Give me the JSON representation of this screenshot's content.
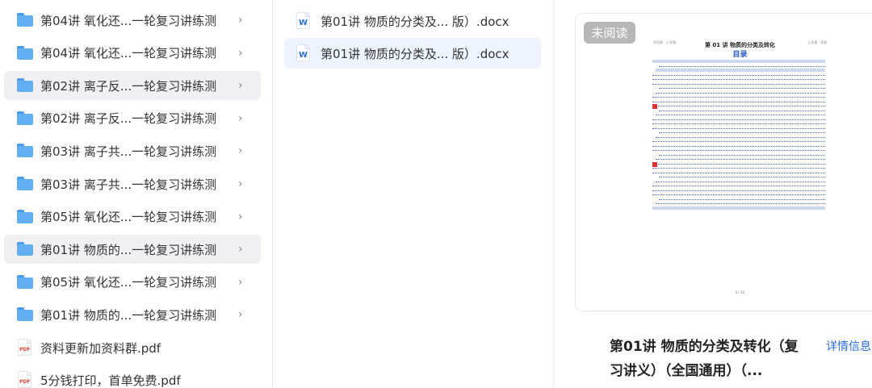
{
  "left_panel": {
    "folders": [
      {
        "label": "第04讲 氧化还...一轮复习讲练测",
        "selected": false
      },
      {
        "label": "第04讲 氧化还...一轮复习讲练测",
        "selected": false
      },
      {
        "label": "第02讲 离子反...一轮复习讲练测",
        "selected": true
      },
      {
        "label": "第02讲 离子反...一轮复习讲练测",
        "selected": false
      },
      {
        "label": "第03讲 离子共...一轮复习讲练测",
        "selected": false
      },
      {
        "label": "第03讲 离子共...一轮复习讲练测",
        "selected": false
      },
      {
        "label": "第05讲 氧化还...一轮复习讲练测",
        "selected": false
      },
      {
        "label": "第01讲 物质的...一轮复习讲练测",
        "selected": true
      },
      {
        "label": "第05讲 氧化还...一轮复习讲练测",
        "selected": false
      },
      {
        "label": "第01讲 物质的...一轮复习讲练测",
        "selected": false
      }
    ],
    "chevron": "›",
    "pdf_files": [
      {
        "label": "资料更新加资料群.pdf"
      },
      {
        "label": "5分钱打印，首单免费.pdf"
      }
    ],
    "pdf_tag": "PDF"
  },
  "middle_panel": {
    "files": [
      {
        "label": "第01讲  物质的分类及... 版）.docx",
        "selected": false
      },
      {
        "label": "第01讲  物质的分类及... 版）.docx",
        "selected": true
      }
    ],
    "word_tag": "W"
  },
  "preview": {
    "unread_badge": "未阅读",
    "doc_header_left": "学科网 · 上学通",
    "doc_header_right": "上学通 · 资源",
    "doc_title": "第 01 讲   物质的分类及转化",
    "doc_toc_title": "目录",
    "doc_page_number": "1 / 31",
    "file_title": "第01讲  物质的分类及转化（复习讲义）（全国通用）（...",
    "details_link": "详情信息"
  },
  "colors": {
    "selected_row_bg": "#f0f0f2",
    "selected_file_bg": "#eef3fd",
    "folder_blue": "#62aef0",
    "link_blue": "#2a6fd1",
    "badge_gray": "#b7b7b7"
  }
}
